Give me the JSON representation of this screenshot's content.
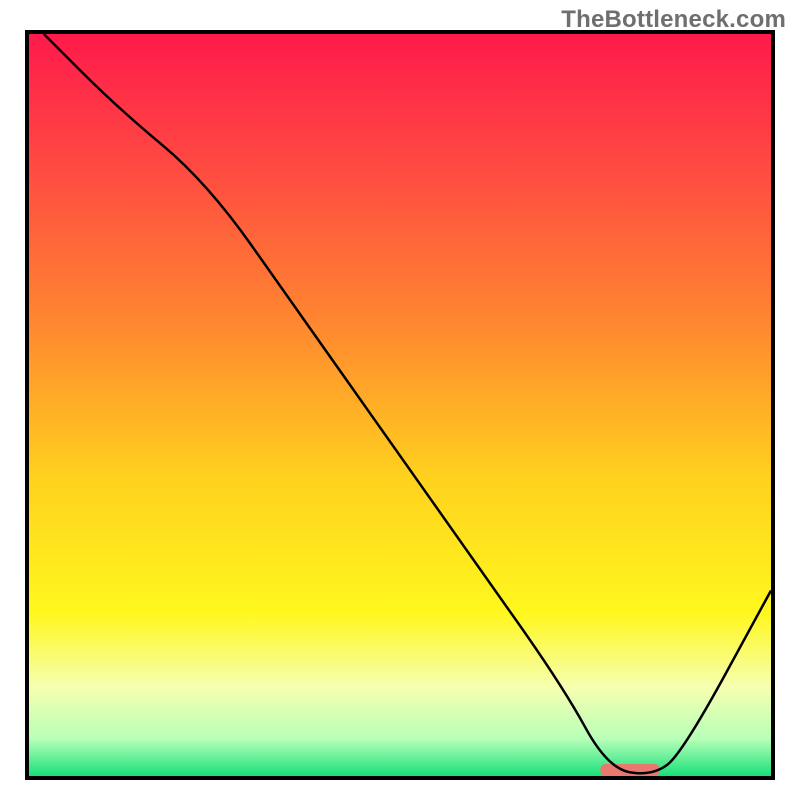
{
  "watermark": "TheBottleneck.com",
  "chart_data": {
    "type": "line",
    "title": "",
    "xlabel": "",
    "ylabel": "",
    "xlim": [
      0,
      100
    ],
    "ylim": [
      0,
      100
    ],
    "grid": false,
    "series": [
      {
        "name": "bottleneck-curve",
        "x": [
          2,
          12,
          24,
          36,
          48,
          60,
          72,
          78,
          84,
          88,
          100
        ],
        "values": [
          100,
          90,
          80,
          63,
          46,
          29,
          12,
          1,
          0,
          3,
          25
        ]
      }
    ],
    "marker": {
      "name": "optimal-range",
      "shape": "rounded-bar",
      "x_start": 77,
      "x_end": 85,
      "y": 0,
      "color": "#e8796e"
    },
    "background_gradient": {
      "stops": [
        {
          "offset": 0.0,
          "color": "#ff1a4b"
        },
        {
          "offset": 0.18,
          "color": "#ff4a42"
        },
        {
          "offset": 0.4,
          "color": "#ff8a2f"
        },
        {
          "offset": 0.6,
          "color": "#ffd21e"
        },
        {
          "offset": 0.78,
          "color": "#fff71e"
        },
        {
          "offset": 0.88,
          "color": "#f6ffb0"
        },
        {
          "offset": 0.95,
          "color": "#b8ffb8"
        },
        {
          "offset": 1.0,
          "color": "#18e07a"
        }
      ]
    }
  }
}
